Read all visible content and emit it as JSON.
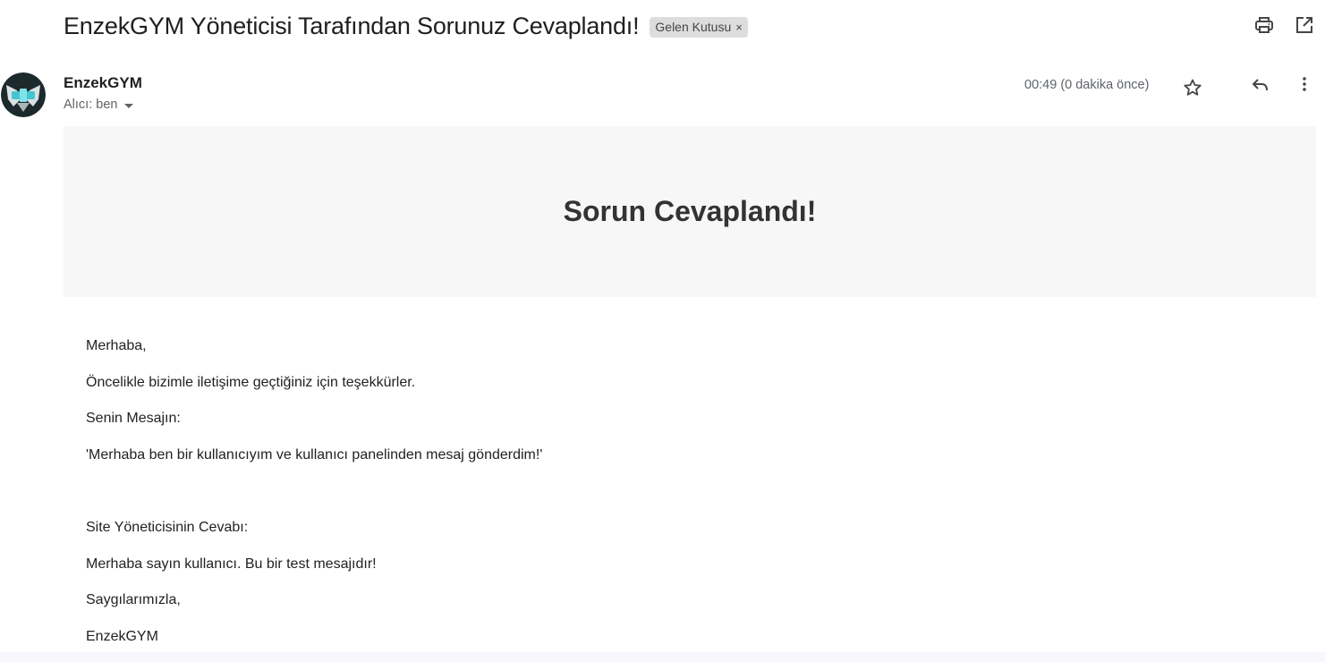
{
  "email": {
    "subject": "EnzekGYM Yöneticisi Tarafından Sorunuz Cevaplandı!",
    "label": "Gelen Kutusu",
    "label_remove": "×",
    "sender_name": "EnzekGYM",
    "recipient": "Alıcı: ben",
    "timestamp": "00:49 (0 dakika önce)"
  },
  "icons": {
    "print": "print-icon",
    "open_new_window": "open-in-new-window-icon",
    "star": "star-icon",
    "reply": "reply-icon",
    "more": "more-vert-icon",
    "recipient_dropdown": "caret-down-icon"
  },
  "message": {
    "banner_title": "Sorun Cevaplandı!",
    "greeting": "Merhaba,",
    "thanks": "Öncelikle bizimle iletişime geçtiğiniz için teşekkürler.",
    "your_message_label": "Senin Mesajın:",
    "your_message": "'Merhaba ben bir kullanıcıyım ve kullanıcı panelinden mesaj gönderdim!'",
    "admin_reply_label": "Site Yöneticisinin Cevabı:",
    "admin_reply": "Merhaba sayın kullanıcı. Bu bir test mesajıdır!",
    "closing": "Saygılarımızla,",
    "signature": "EnzekGYM"
  },
  "colors": {
    "banner_bg": "#f7f7f7",
    "label_chip_bg": "#dddddd",
    "text_secondary": "#5f6368",
    "avatar_bg": "#1c2a2d",
    "avatar_accent": "#43c6d0"
  }
}
